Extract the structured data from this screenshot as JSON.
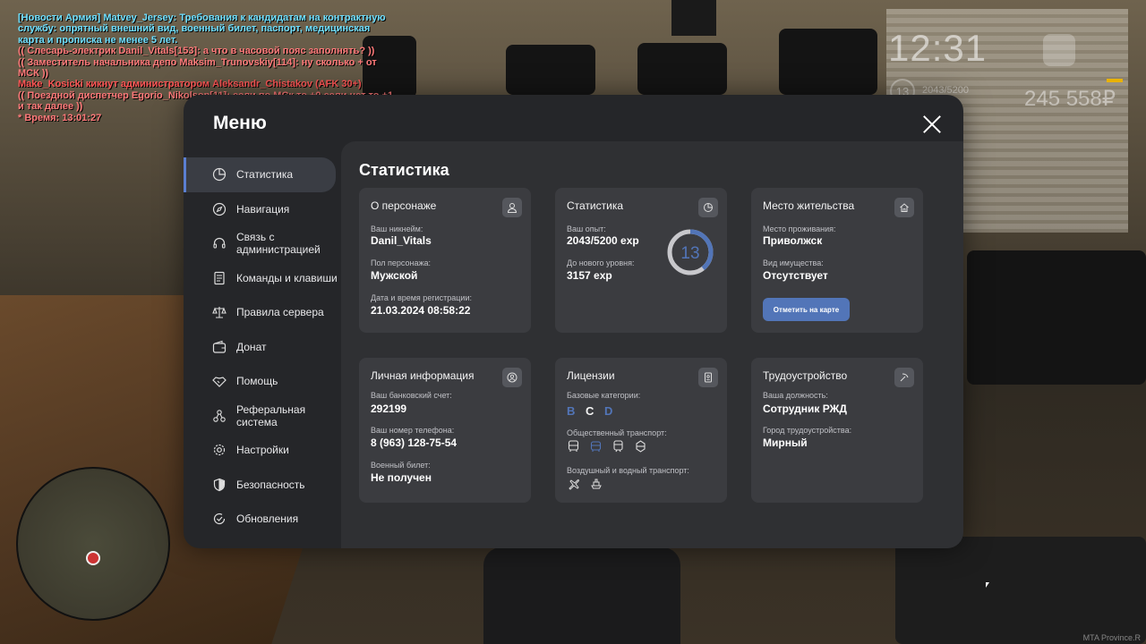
{
  "chat": [
    {
      "text": "[Новости Армия] Matvey_Jersey: Требования к кандидатам на контрактную службу: опрятный внешний вид, военный билет, паспорт, медицинская карта и прописка не менее 5 лет.",
      "color": "cyan"
    },
    {
      "text": "(( Слесарь-электрик Danil_Vitals[153]: а что в часовой пояс заполнять? ))",
      "color": "pink"
    },
    {
      "text": "(( Заместитель начальника депо Maksim_Trunovskiy[114]: ну сколько + от МСК ))",
      "color": "pink"
    },
    {
      "text": "Make_Kosicki кикнут администратором Aleksandr_Chistakov (AFK 30+)",
      "color": "red"
    },
    {
      "text": "(( Поездной диспетчер Egorio_Nikolson[11]: если по МСк то +0 если нет то +1 и так далее ))",
      "color": "pink"
    },
    {
      "text": "* Время: 13:01:27",
      "color": "pink"
    }
  ],
  "hud": {
    "clock": "12:31",
    "level": "13",
    "exp": "2043/5200",
    "money": "245 558₽"
  },
  "watermark": "MTA Province.R",
  "menu": {
    "title": "Меню",
    "nav": [
      {
        "label": "Статистика",
        "icon": "pie-chart-icon",
        "active": true
      },
      {
        "label": "Навигация",
        "icon": "compass-icon"
      },
      {
        "label": "Связь с администрацией",
        "icon": "headset-icon"
      },
      {
        "label": "Команды и клавиши",
        "icon": "document-icon"
      },
      {
        "label": "Правила сервера",
        "icon": "scales-icon"
      },
      {
        "label": "Донат",
        "icon": "wallet-icon"
      },
      {
        "label": "Помощь",
        "icon": "handshake-icon"
      },
      {
        "label": "Реферальная система",
        "icon": "network-icon"
      },
      {
        "label": "Настройки",
        "icon": "gear-icon"
      },
      {
        "label": "Безопасность",
        "icon": "shield-icon"
      },
      {
        "label": "Обновления",
        "icon": "refresh-check-icon"
      }
    ]
  },
  "content": {
    "title": "Статистика",
    "character": {
      "title": "О персонаже",
      "nick_label": "Ваш никнейм:",
      "nick": "Danil_Vitals",
      "gender_label": "Пол персонажа:",
      "gender": "Мужской",
      "reg_label": "Дата и время регистрации:",
      "reg": "21.03.2024 08:58:22"
    },
    "stats": {
      "title": "Статистика",
      "exp_label": "Ваш опыт:",
      "exp": "2043/5200 exp",
      "next_label": "До нового уровня:",
      "next": "3157 exp",
      "level": "13",
      "exp_fraction": 0.393
    },
    "residence": {
      "title": "Место жительства",
      "place_label": "Место проживания:",
      "place": "Приволжск",
      "property_label": "Вид имущества:",
      "property": "Отсутствует",
      "button": "Отметить на карте"
    },
    "personal": {
      "title": "Личная информация",
      "bank_label": "Ваш банковский счет:",
      "bank": "292199",
      "phone_label": "Ваш номер телефона:",
      "phone": "8 (963) 128-75-54",
      "military_label": "Военный билет:",
      "military": "Не получен"
    },
    "licenses": {
      "title": "Лицензии",
      "base_label": "Базовые категории:",
      "categories": [
        "B",
        "C",
        "D"
      ],
      "public_label": "Общественный транспорт:",
      "air_label": "Воздушный и водный транспорт:"
    },
    "employment": {
      "title": "Трудоустройство",
      "position_label": "Ваша должность:",
      "position": "Сотрудник РЖД",
      "city_label": "Город трудоустройства:",
      "city": "Мирный"
    }
  },
  "colors": {
    "accent": "#5275b8",
    "panel": "#252629",
    "card": "#3b3c40"
  }
}
